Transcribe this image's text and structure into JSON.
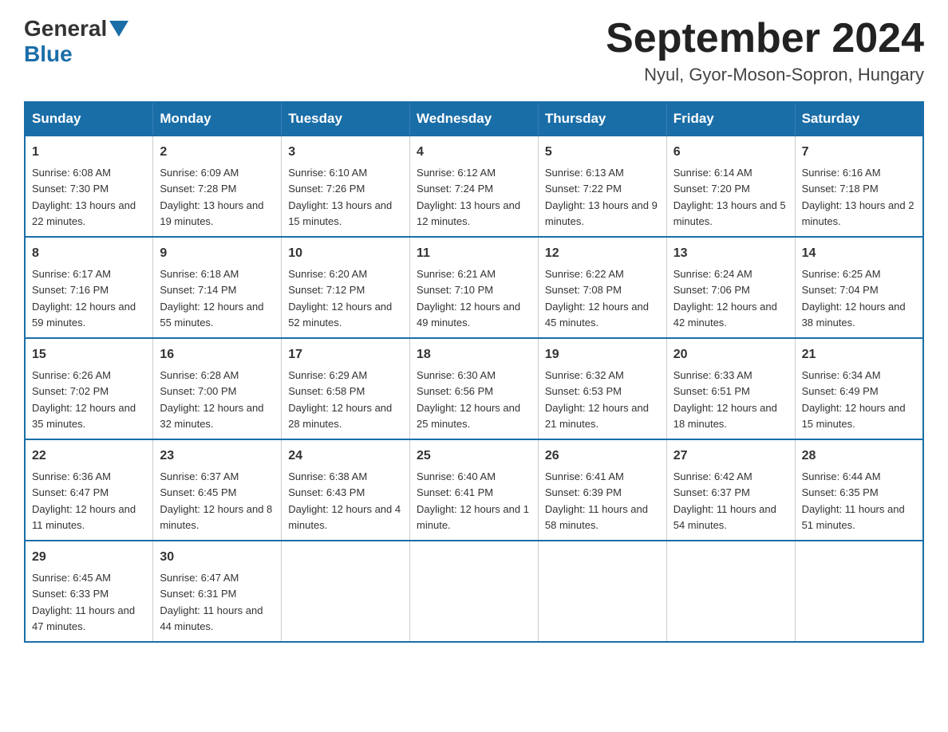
{
  "header": {
    "logo": {
      "general": "General",
      "blue": "Blue"
    },
    "title": "September 2024",
    "location": "Nyul, Gyor-Moson-Sopron, Hungary"
  },
  "weekdays": [
    "Sunday",
    "Monday",
    "Tuesday",
    "Wednesday",
    "Thursday",
    "Friday",
    "Saturday"
  ],
  "weeks": [
    [
      {
        "day": "1",
        "sunrise": "6:08 AM",
        "sunset": "7:30 PM",
        "daylight": "13 hours and 22 minutes."
      },
      {
        "day": "2",
        "sunrise": "6:09 AM",
        "sunset": "7:28 PM",
        "daylight": "13 hours and 19 minutes."
      },
      {
        "day": "3",
        "sunrise": "6:10 AM",
        "sunset": "7:26 PM",
        "daylight": "13 hours and 15 minutes."
      },
      {
        "day": "4",
        "sunrise": "6:12 AM",
        "sunset": "7:24 PM",
        "daylight": "13 hours and 12 minutes."
      },
      {
        "day": "5",
        "sunrise": "6:13 AM",
        "sunset": "7:22 PM",
        "daylight": "13 hours and 9 minutes."
      },
      {
        "day": "6",
        "sunrise": "6:14 AM",
        "sunset": "7:20 PM",
        "daylight": "13 hours and 5 minutes."
      },
      {
        "day": "7",
        "sunrise": "6:16 AM",
        "sunset": "7:18 PM",
        "daylight": "13 hours and 2 minutes."
      }
    ],
    [
      {
        "day": "8",
        "sunrise": "6:17 AM",
        "sunset": "7:16 PM",
        "daylight": "12 hours and 59 minutes."
      },
      {
        "day": "9",
        "sunrise": "6:18 AM",
        "sunset": "7:14 PM",
        "daylight": "12 hours and 55 minutes."
      },
      {
        "day": "10",
        "sunrise": "6:20 AM",
        "sunset": "7:12 PM",
        "daylight": "12 hours and 52 minutes."
      },
      {
        "day": "11",
        "sunrise": "6:21 AM",
        "sunset": "7:10 PM",
        "daylight": "12 hours and 49 minutes."
      },
      {
        "day": "12",
        "sunrise": "6:22 AM",
        "sunset": "7:08 PM",
        "daylight": "12 hours and 45 minutes."
      },
      {
        "day": "13",
        "sunrise": "6:24 AM",
        "sunset": "7:06 PM",
        "daylight": "12 hours and 42 minutes."
      },
      {
        "day": "14",
        "sunrise": "6:25 AM",
        "sunset": "7:04 PM",
        "daylight": "12 hours and 38 minutes."
      }
    ],
    [
      {
        "day": "15",
        "sunrise": "6:26 AM",
        "sunset": "7:02 PM",
        "daylight": "12 hours and 35 minutes."
      },
      {
        "day": "16",
        "sunrise": "6:28 AM",
        "sunset": "7:00 PM",
        "daylight": "12 hours and 32 minutes."
      },
      {
        "day": "17",
        "sunrise": "6:29 AM",
        "sunset": "6:58 PM",
        "daylight": "12 hours and 28 minutes."
      },
      {
        "day": "18",
        "sunrise": "6:30 AM",
        "sunset": "6:56 PM",
        "daylight": "12 hours and 25 minutes."
      },
      {
        "day": "19",
        "sunrise": "6:32 AM",
        "sunset": "6:53 PM",
        "daylight": "12 hours and 21 minutes."
      },
      {
        "day": "20",
        "sunrise": "6:33 AM",
        "sunset": "6:51 PM",
        "daylight": "12 hours and 18 minutes."
      },
      {
        "day": "21",
        "sunrise": "6:34 AM",
        "sunset": "6:49 PM",
        "daylight": "12 hours and 15 minutes."
      }
    ],
    [
      {
        "day": "22",
        "sunrise": "6:36 AM",
        "sunset": "6:47 PM",
        "daylight": "12 hours and 11 minutes."
      },
      {
        "day": "23",
        "sunrise": "6:37 AM",
        "sunset": "6:45 PM",
        "daylight": "12 hours and 8 minutes."
      },
      {
        "day": "24",
        "sunrise": "6:38 AM",
        "sunset": "6:43 PM",
        "daylight": "12 hours and 4 minutes."
      },
      {
        "day": "25",
        "sunrise": "6:40 AM",
        "sunset": "6:41 PM",
        "daylight": "12 hours and 1 minute."
      },
      {
        "day": "26",
        "sunrise": "6:41 AM",
        "sunset": "6:39 PM",
        "daylight": "11 hours and 58 minutes."
      },
      {
        "day": "27",
        "sunrise": "6:42 AM",
        "sunset": "6:37 PM",
        "daylight": "11 hours and 54 minutes."
      },
      {
        "day": "28",
        "sunrise": "6:44 AM",
        "sunset": "6:35 PM",
        "daylight": "11 hours and 51 minutes."
      }
    ],
    [
      {
        "day": "29",
        "sunrise": "6:45 AM",
        "sunset": "6:33 PM",
        "daylight": "11 hours and 47 minutes."
      },
      {
        "day": "30",
        "sunrise": "6:47 AM",
        "sunset": "6:31 PM",
        "daylight": "11 hours and 44 minutes."
      },
      null,
      null,
      null,
      null,
      null
    ]
  ]
}
